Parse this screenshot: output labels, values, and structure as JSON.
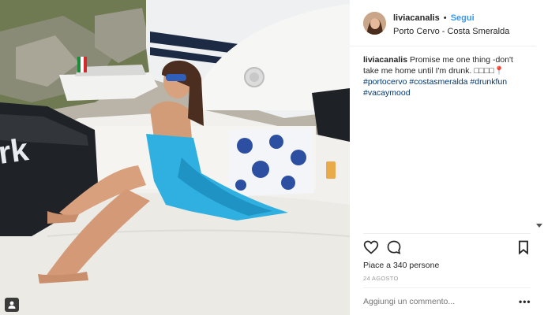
{
  "post": {
    "username": "liviacanalis",
    "separator": "•",
    "follow_label": "Segui",
    "location": "Porto Cervo - Costa Smeralda",
    "caption_user": "liviacanalis",
    "caption_text": "Promise me one thing -don't take me home until I'm drunk. ",
    "caption_emoji": "□□□□",
    "hashtags": [
      "#portocervo",
      "#costasmeralda",
      "#drunkfun",
      "#vacaymood"
    ],
    "likes_text": "Piace a 340 persone",
    "date": "24 AGOSTO",
    "comment_placeholder": "Aggiungi un commento...",
    "more_label": "•••",
    "photo_overlay_text": "rk"
  },
  "icons": {
    "like": "heart-icon",
    "comment": "speech-bubble-icon",
    "save": "bookmark-icon",
    "user_tag": "person-icon",
    "scroll": "chevron-down-icon"
  },
  "colors": {
    "link": "#003569",
    "follow": "#3897f0",
    "towel": "#2fb0e0",
    "muted": "#999999"
  }
}
